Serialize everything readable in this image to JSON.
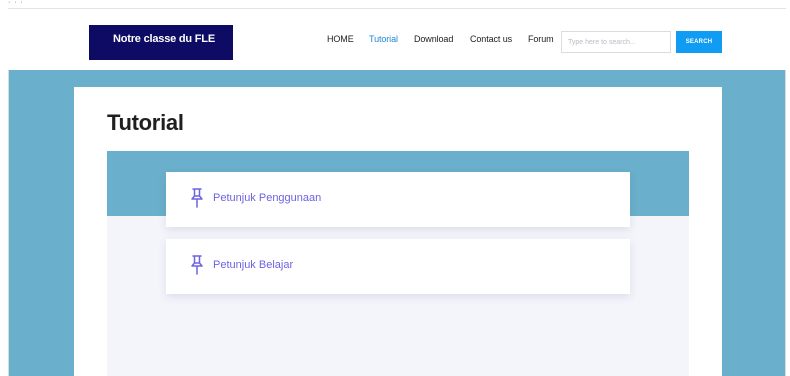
{
  "brand": {
    "name": "Notre classe du FLE"
  },
  "nav": {
    "items": [
      {
        "label": "HOME",
        "active": false
      },
      {
        "label": "Tutorial",
        "active": true
      },
      {
        "label": "Download",
        "active": false
      },
      {
        "label": "Contact us",
        "active": false
      },
      {
        "label": "Forum",
        "active": false
      }
    ]
  },
  "search": {
    "placeholder": "Type here to search...",
    "button_label": "SEARCH"
  },
  "page": {
    "title": "Tutorial"
  },
  "cards": [
    {
      "label": "Petunjuk Penggunaan",
      "icon": "pin-icon"
    },
    {
      "label": "Petunjuk Belajar",
      "icon": "pin-icon"
    }
  ],
  "colors": {
    "background": "#6aafcb",
    "brand_bg": "#0d0b63",
    "accent": "#1e88d8",
    "search_button": "#0f9cf2",
    "card_text": "#6c63e0"
  }
}
